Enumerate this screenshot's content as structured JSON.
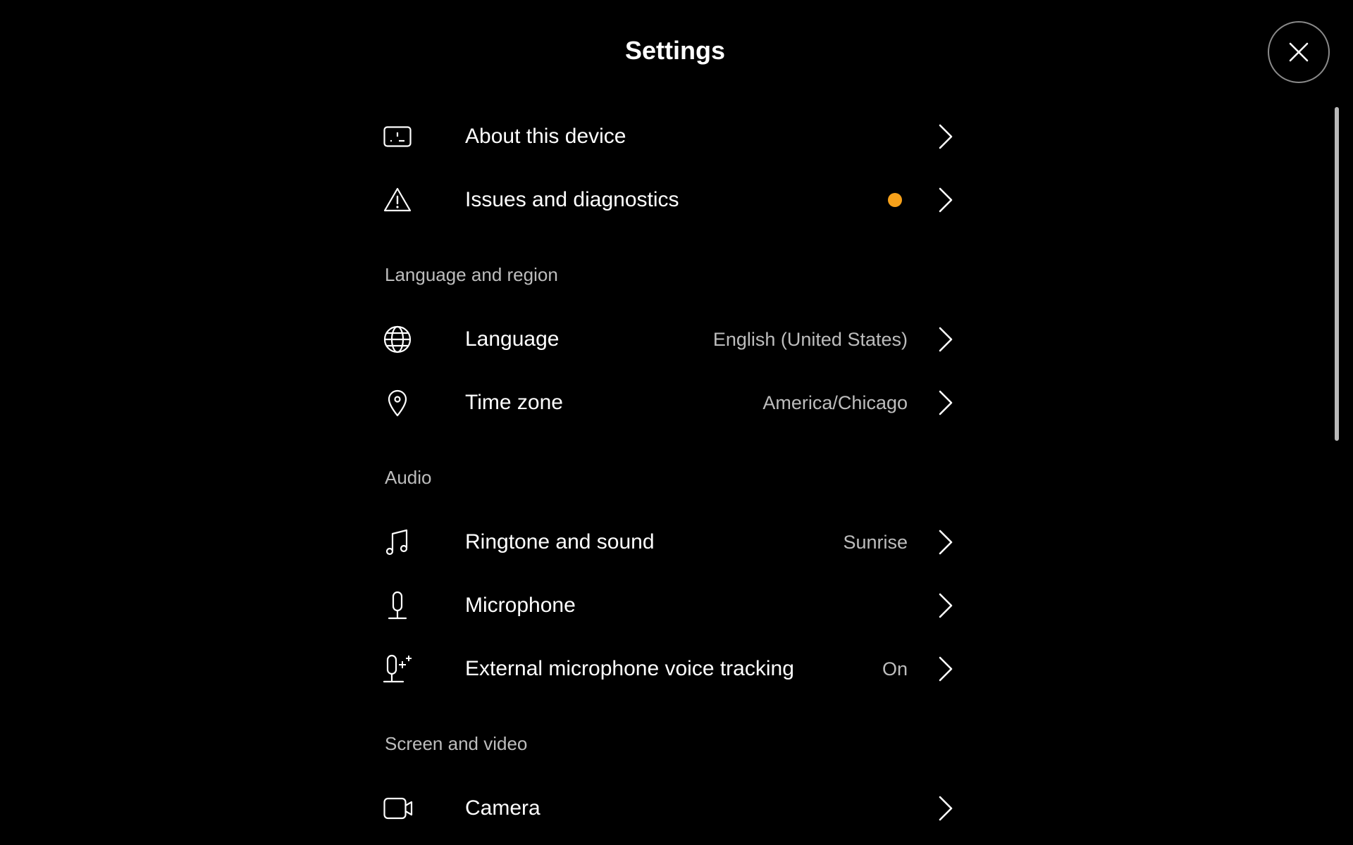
{
  "header": {
    "title": "Settings",
    "close_icon": "close-icon"
  },
  "colors": {
    "background": "#000000",
    "text": "#ffffff",
    "secondary_text": "#bdbdbd",
    "warning_dot": "#f7a11a"
  },
  "items": {
    "about": {
      "label": "About this device",
      "icon": "device-icon"
    },
    "issues": {
      "label": "Issues and diagnostics",
      "icon": "warning-icon",
      "badge": "warning-dot"
    },
    "language": {
      "label": "Language",
      "value": "English (United States)",
      "icon": "globe-icon"
    },
    "timezone": {
      "label": "Time zone",
      "value": "America/Chicago",
      "icon": "location-pin-icon"
    },
    "ringtone": {
      "label": "Ringtone and sound",
      "value": "Sunrise",
      "icon": "music-note-icon"
    },
    "microphone": {
      "label": "Microphone",
      "icon": "microphone-icon"
    },
    "voice_tracking": {
      "label": "External microphone voice tracking",
      "value": "On",
      "icon": "microphone-sparkle-icon"
    },
    "camera": {
      "label": "Camera",
      "icon": "camera-icon"
    }
  },
  "sections": {
    "language_region": "Language and region",
    "audio": "Audio",
    "screen_video": "Screen and video"
  }
}
